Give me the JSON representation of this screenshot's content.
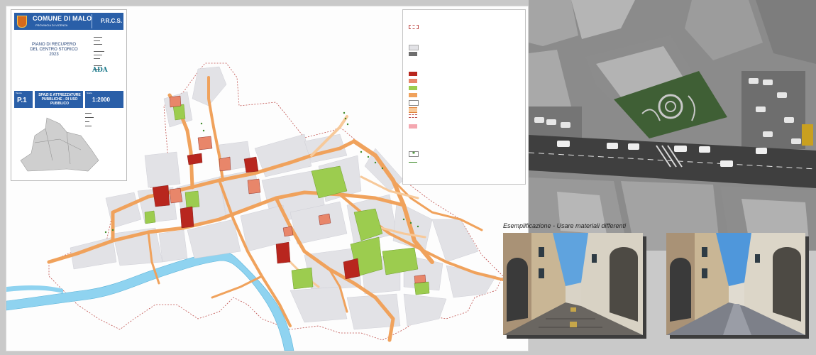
{
  "title_block": {
    "comune": "COMUNE DI MALO",
    "provincia": "PROVINCIA DI VICENZA",
    "acronym": "P.R.C.S.",
    "plan_line1": "PIANO DI RECUPERO",
    "plan_line2": "DEL CENTRO STORICO",
    "year": "2023",
    "tavola_label": "Tavola",
    "tavola": "P.1",
    "subject_line1": "SPAZI E ATTREZZATURE",
    "subject_line2": "PUBBLICHE - DI USO PUBBLICO",
    "scala_label": "Scala",
    "scala": "1:2000",
    "logo": "ADA"
  },
  "caption": "Esemplificazione - Usare materiali differenti",
  "colors": {
    "title_blue": "#2a5fa8",
    "road_orange": "#f0a25c",
    "road_light": "#f7c99a",
    "building_red": "#b8261e",
    "building_salmon": "#e8866a",
    "green_area": "#9ccc4f",
    "building_grey": "#e2e2e6",
    "river_blue": "#8fd3f0",
    "boundary_red": "#c0504d"
  },
  "icons": {
    "comune_crest": "municipal-crest-icon",
    "compass": "none"
  }
}
